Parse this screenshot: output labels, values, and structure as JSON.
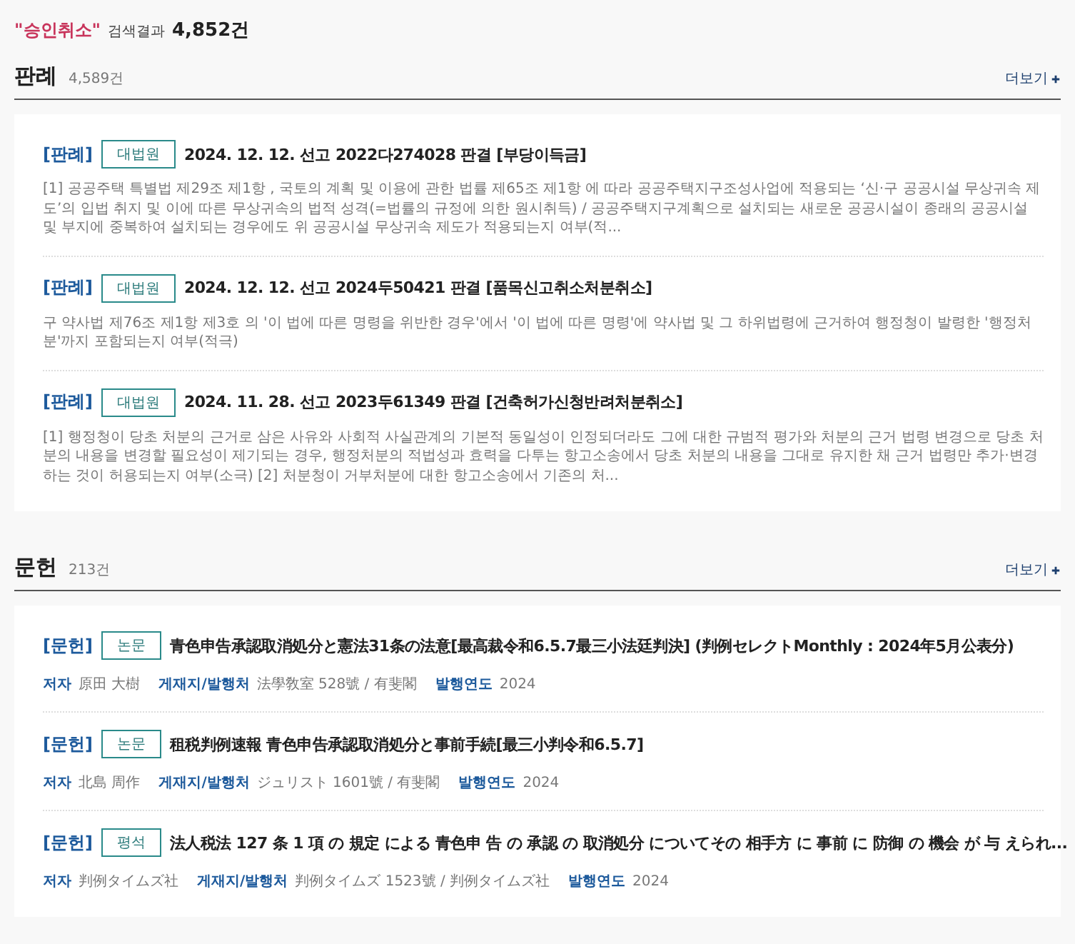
{
  "summary": {
    "query": "\"승인취소\"",
    "label": "검색결과",
    "count": "4,852건"
  },
  "sections": [
    {
      "title": "판례",
      "count": "4,589건",
      "more": "더보기",
      "items": [
        {
          "category": "[판례]",
          "badge": "대법원",
          "title": "2024. 12. 12. 선고 2022다274028 판결 [부당이득금]",
          "summary": "[1] 공공주택 특별법 제29조 제1항 , 국토의 계획 및 이용에 관한 법률 제65조 제1항 에 따라 공공주택지구조성사업에 적용되는 ‘신·구 공공시설 무상귀속 제도’의 입법 취지 및 이에 따른 무상귀속의 법적 성격(=법률의 규정에 의한 원시취득) / 공공주택지구계획으로 설치되는 새로운 공공시설이 종래의 공공시설 및 부지에 중복하여 설치되는 경우에도 위 공공시설 무상귀속 제도가 적용되는지 여부(적..."
        },
        {
          "category": "[판례]",
          "badge": "대법원",
          "title": "2024. 12. 12. 선고 2024두50421 판결 [품목신고취소처분취소]",
          "summary": "구 약사법 제76조 제1항 제3호 의 '이 법에 따른 명령을 위반한 경우'에서 '이 법에 따른 명령'에 약사법 및 그 하위법령에 근거하여 행정청이 발령한 '행정처분'까지 포함되는지 여부(적극)"
        },
        {
          "category": "[판례]",
          "badge": "대법원",
          "title": "2024. 11. 28. 선고 2023두61349 판결 [건축허가신청반려처분취소]",
          "summary": "[1] 행정청이 당초 처분의 근거로 삼은 사유와 사회적 사실관계의 기본적 동일성이 인정되더라도 그에 대한 규범적 평가와 처분의 근거 법령 변경으로 당초 처분의 내용을 변경할 필요성이 제기되는 경우, 행정처분의 적법성과 효력을 다투는 항고소송에서 당초 처분의 내용을 그대로 유지한 채 근거 법령만 추가·변경하는 것이 허용되는지 여부(소극) [2] 처분청이 거부처분에 대한 항고소송에서 기존의 처..."
        }
      ]
    },
    {
      "title": "문헌",
      "count": "213건",
      "more": "더보기",
      "items": [
        {
          "category": "[문헌]",
          "badge": "논문",
          "title": "青色申告承認取消処分と憲法31条の法意[最高裁令和6.5.7最三小法廷判決] (判例セレクトMonthly : 2024年5月公表分)",
          "meta": [
            {
              "label": "저자",
              "value": "原田 大樹"
            },
            {
              "label": "게재지/발행처",
              "value": "法學敎室 528號 / 有斐閣"
            },
            {
              "label": "발행연도",
              "value": "2024"
            }
          ]
        },
        {
          "category": "[문헌]",
          "badge": "논문",
          "title": "租税判例速報 青色申告承認取消処分と事前手続[最三小判令和6.5.7]",
          "meta": [
            {
              "label": "저자",
              "value": "北島 周作"
            },
            {
              "label": "게재지/발행처",
              "value": "ジュリスト 1601號 / 有斐閣"
            },
            {
              "label": "발행연도",
              "value": "2024"
            }
          ]
        },
        {
          "category": "[문헌]",
          "badge": "평석",
          "title": "法人税法 127 条 1 項 の 規定 による 青色申 告 の 承認 の 取消処分 についてその 相手方 に 事前 に 防御 の 機会 が 与 えられ...",
          "meta": [
            {
              "label": "저자",
              "value": "判例タイムズ社"
            },
            {
              "label": "게재지/발행처",
              "value": "判例タイムズ 1523號 / 判例タイムズ社"
            },
            {
              "label": "발행연도",
              "value": "2024"
            }
          ]
        }
      ]
    }
  ]
}
